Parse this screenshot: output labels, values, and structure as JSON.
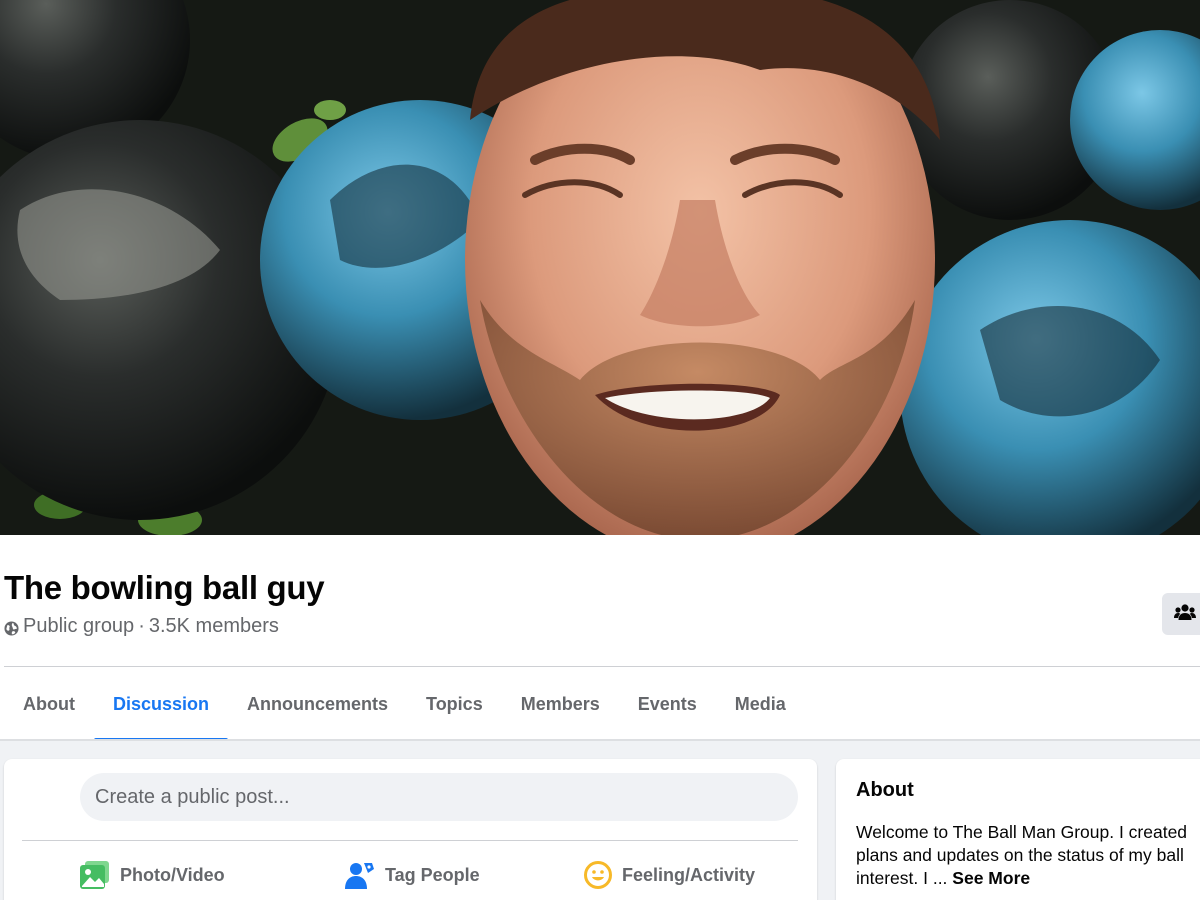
{
  "cover": {
    "description_icon": "cover-photo"
  },
  "group": {
    "name": "The bowling ball guy",
    "privacy_icon": "globe-icon",
    "privacy": "Public group",
    "separator": " · ",
    "members": "3.5K members"
  },
  "header_actions": {
    "members_icon": "people-icon"
  },
  "tabs": [
    {
      "label": "About",
      "active": false
    },
    {
      "label": "Discussion",
      "active": true
    },
    {
      "label": "Announcements",
      "active": false
    },
    {
      "label": "Topics",
      "active": false
    },
    {
      "label": "Members",
      "active": false
    },
    {
      "label": "Events",
      "active": false
    },
    {
      "label": "Media",
      "active": false
    }
  ],
  "composer": {
    "placeholder": "Create a public post...",
    "actions": [
      {
        "label": "Photo/Video",
        "icon": "photo-icon",
        "color": "#45bd62"
      },
      {
        "label": "Tag People",
        "icon": "tag-people-icon",
        "color": "#1877f2"
      },
      {
        "label": "Feeling/Activity",
        "icon": "feeling-icon",
        "color": "#f7b928"
      }
    ]
  },
  "about": {
    "title": "About",
    "lines": [
      "Welcome to The Ball Man Group. I created",
      "plans and updates on the status of my ball",
      "interest. I ... "
    ],
    "see_more": "See More"
  },
  "colors": {
    "accent": "#1877f2",
    "secondary_text": "#65676b",
    "page_background": "#f0f2f5"
  }
}
